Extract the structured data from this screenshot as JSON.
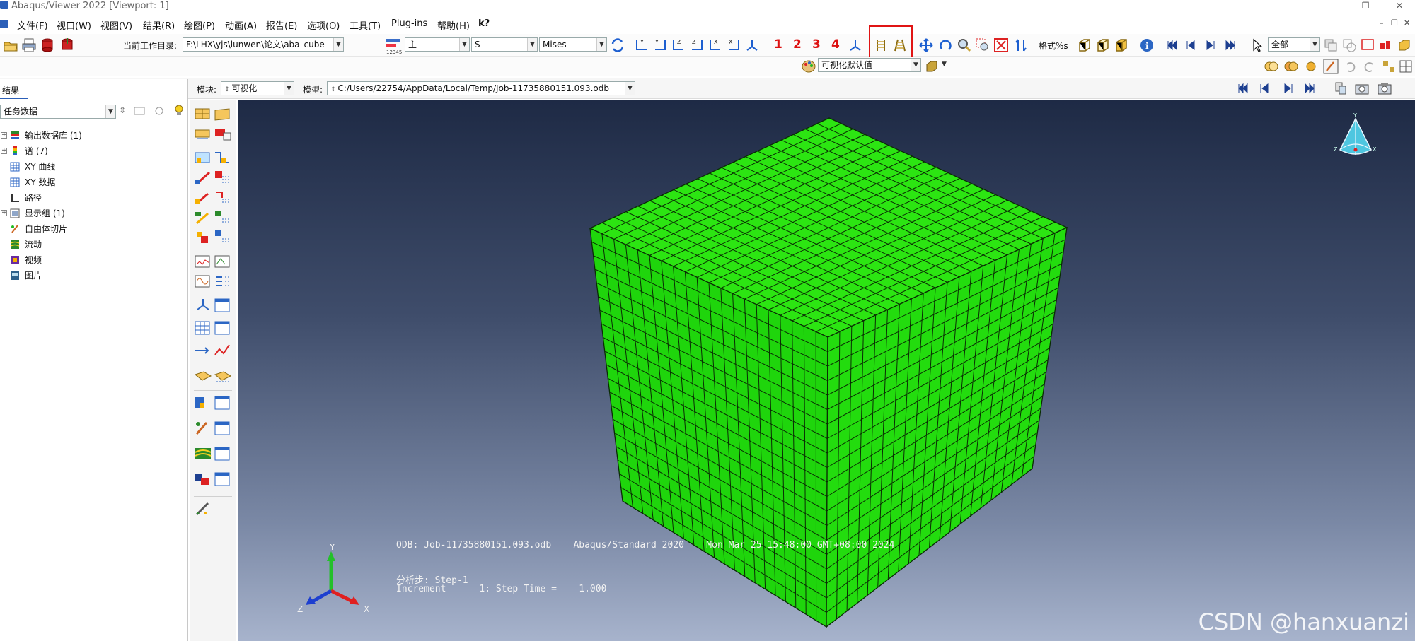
{
  "window": {
    "title": "Abaqus/Viewer 2022 [Viewport: 1]",
    "controls": [
      "–",
      "❐",
      "✕"
    ]
  },
  "menubar": {
    "items": [
      "文件(F)",
      "视口(W)",
      "视图(V)",
      "结果(R)",
      "绘图(P)",
      "动画(A)",
      "报告(E)",
      "选项(O)",
      "工具(T)",
      "Plug-ins",
      "帮助(H)",
      "k?"
    ],
    "sub_controls": [
      "–",
      "❐",
      "✕"
    ]
  },
  "toolbar": {
    "workdir_label": "当前工作目录:",
    "workdir_value": "F:\\LHX\\yjs\\lunwen\\论文\\aba_cube",
    "primary_value": "主",
    "variable_value": "S",
    "invariant_value": "Mises",
    "view_numbers": [
      "1",
      "2",
      "3",
      "4"
    ],
    "format_label": "格式%s",
    "selection_value": "全部",
    "visual_defaults": "可视化默认值"
  },
  "context_bar": {
    "module_label": "模块:",
    "module_value": "可视化",
    "model_label": "模型:",
    "model_value": "C:/Users/22754/AppData/Local/Temp/Job-11735880151.093.odb"
  },
  "left_panel": {
    "tab_label": "结果",
    "filter_value": "任务数据",
    "tree": [
      {
        "label": "输出数据库 (1)",
        "expandable": true,
        "icon": "database-icon"
      },
      {
        "label": "谱 (7)",
        "expandable": true,
        "icon": "spectrum-icon"
      },
      {
        "label": "XY 曲线",
        "expandable": false,
        "icon": "grid-icon"
      },
      {
        "label": "XY 数据",
        "expandable": false,
        "icon": "grid-icon"
      },
      {
        "label": "路径",
        "expandable": false,
        "icon": "path-icon"
      },
      {
        "label": "显示组 (1)",
        "expandable": true,
        "icon": "display-group-icon"
      },
      {
        "label": "自由体切片",
        "expandable": false,
        "icon": "free-body-icon"
      },
      {
        "label": "流动",
        "expandable": false,
        "icon": "stream-icon"
      },
      {
        "label": "视频",
        "expandable": false,
        "icon": "movie-icon"
      },
      {
        "label": "图片",
        "expandable": false,
        "icon": "image-icon"
      }
    ]
  },
  "viewport": {
    "odb_line": "ODB: Job-11735880151.093.odb    Abaqus/Standard 2020    Mon Mar 25 15:48:00 GMT+08:00 2024",
    "step_line": "分析步: Step-1",
    "increment_line": "Increment      1: Step Time =    1.000",
    "watermark": "CSDN @hanxuanzi",
    "triad_labels": {
      "y": "Y",
      "x": "X",
      "z": "Z"
    },
    "colors": {
      "mesh_fill": "#2ce512",
      "mesh_line": "#0a2c04",
      "bg_top": "#1e2a45",
      "bg_bottom": "#a7b3cc"
    }
  }
}
